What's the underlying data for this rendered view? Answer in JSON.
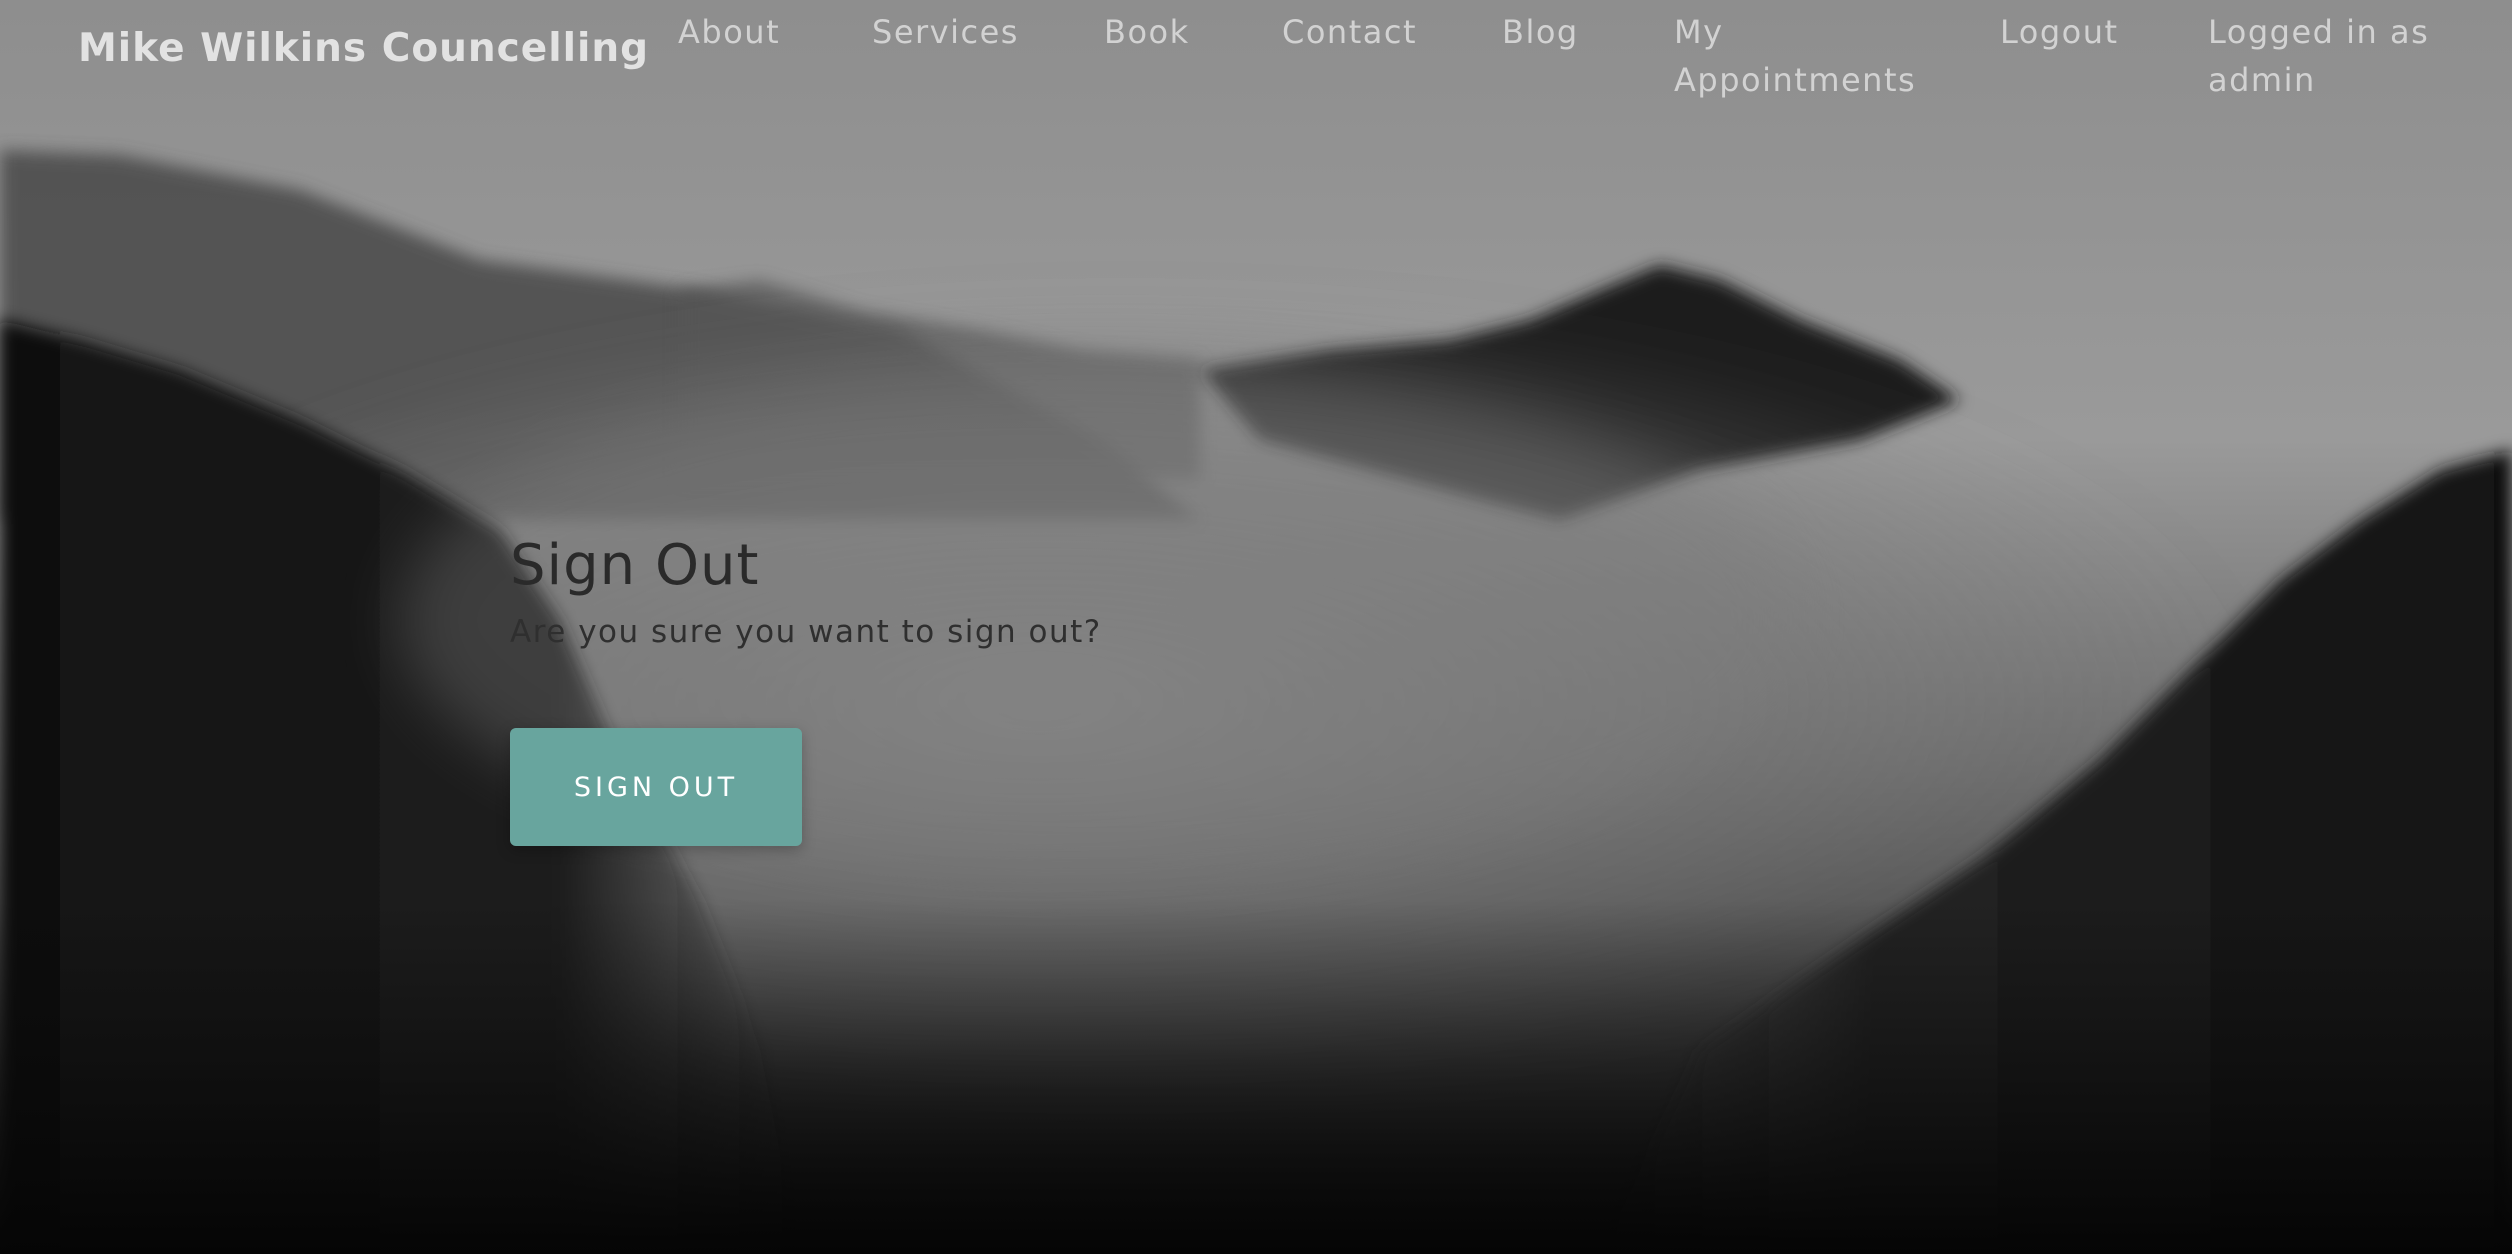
{
  "nav": {
    "brand": "Mike Wilkins Councelling",
    "links": [
      {
        "label": "About"
      },
      {
        "label": "Services"
      },
      {
        "label": "Book"
      },
      {
        "label": "Contact"
      },
      {
        "label": "Blog"
      },
      {
        "label": "My Appointments"
      },
      {
        "label": "Logout"
      }
    ],
    "status": "Logged in as admin"
  },
  "main": {
    "title": "Sign Out",
    "subtitle": "Are you sure you want to sign out?",
    "button_label": "SIGN OUT"
  },
  "theme": {
    "button_color": "#68a59e",
    "text_dark": "#2a2a2a",
    "nav_text": "#d2d2d2"
  },
  "background": {
    "icon": "misty-mountain-forest-image"
  }
}
